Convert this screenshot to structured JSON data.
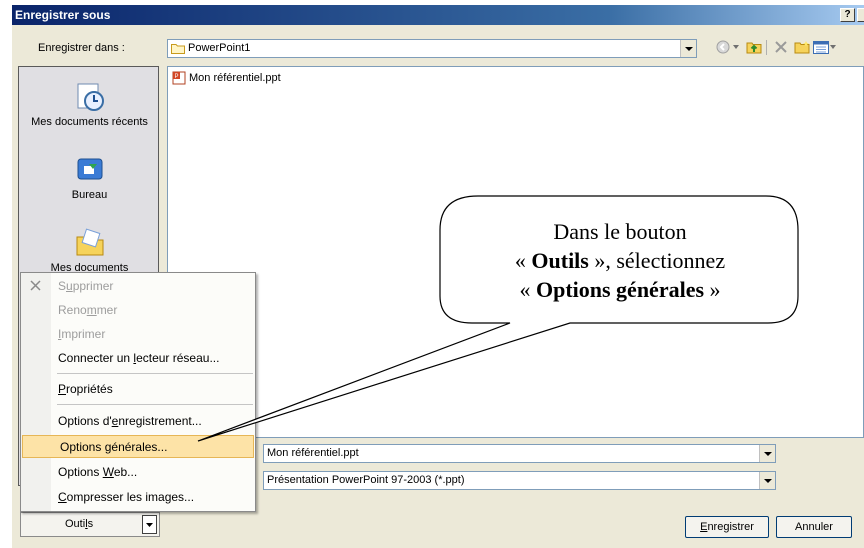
{
  "dialog": {
    "title": "Enregistrer sous",
    "help_button": "?",
    "save_in_label": "Enregistrer dans :",
    "current_folder": "PowerPoint1"
  },
  "places": [
    {
      "label": "Mes documents récents",
      "icon": "recent-documents-icon"
    },
    {
      "label": "Bureau",
      "icon": "desktop-icon"
    },
    {
      "label": "Mes documents",
      "icon": "my-documents-icon"
    }
  ],
  "files": [
    {
      "name": "Mon référentiel.ppt",
      "icon": "powerpoint-file-icon"
    }
  ],
  "menu": {
    "items": [
      {
        "pre": "S",
        "u": "u",
        "post": "pprimer",
        "disabled": true
      },
      {
        "pre": "Reno",
        "u": "m",
        "post": "mer",
        "disabled": true
      },
      {
        "pre": "",
        "u": "I",
        "post": "mprimer",
        "disabled": true
      },
      {
        "pre": "Connecter un ",
        "u": "l",
        "post": "ecteur réseau...",
        "disabled": false
      },
      {
        "pre": "",
        "u": "P",
        "post": "ropriétés",
        "disabled": false
      },
      {
        "pre": "Options d'",
        "u": "e",
        "post": "nregistrement...",
        "disabled": false
      },
      {
        "pre": "Options ",
        "u": "g",
        "post": "énérales...",
        "disabled": false,
        "highlighted": true
      },
      {
        "pre": "Options ",
        "u": "W",
        "post": "eb...",
        "disabled": false
      },
      {
        "pre": "",
        "u": "C",
        "post": "ompresser les images...",
        "disabled": false
      }
    ]
  },
  "filename": {
    "value": "Mon référentiel.ppt"
  },
  "filetype": {
    "value": "Présentation PowerPoint 97-2003 (*.ppt)"
  },
  "buttons": {
    "tools_pre": "Outi",
    "tools_u": "l",
    "tools_post": "s",
    "save_pre": "",
    "save_u": "E",
    "save_post": "nregistrer",
    "cancel": "Annuler"
  },
  "callout": {
    "line1": "Dans le bouton",
    "line2_pre": "« ",
    "line2_bold": "Outils",
    "line2_post": " », sélectionnez",
    "line3_pre": "« ",
    "line3_bold": "Options générales",
    "line3_post": " »"
  },
  "colors": {
    "title_bar": "#0a246a",
    "menu_highlight": "#fde3a7"
  }
}
